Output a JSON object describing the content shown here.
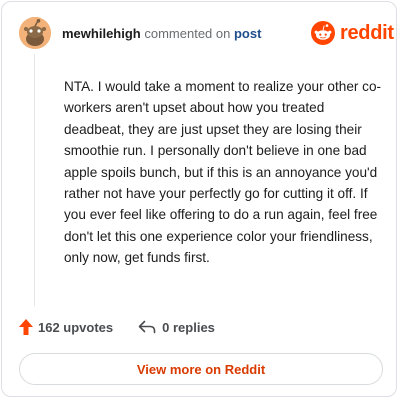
{
  "header": {
    "username": "mewhilehigh",
    "action_text": "commented on",
    "post_link": "post",
    "logo_text": "reddit"
  },
  "comment": {
    "body": "NTA. I would take a moment to realize your other co-workers aren't upset about how you treated deadbeat, they are just upset they are losing their smoothie run. I personally don't believe in one bad apple spoils bunch, but if this is an annoyance you'd rather not have your perfectly go for cutting it off. If you ever feel like offering to do a run again, feel free don't let this one experience color your friendliness, only now, get funds first."
  },
  "actions": {
    "upvotes": "162 upvotes",
    "replies": "0 replies"
  },
  "footer": {
    "view_more_label": "View more on Reddit"
  },
  "colors": {
    "brand": "#ff4500",
    "link": "#1f4e8c",
    "view_more": "#d93a00"
  },
  "icons": {
    "avatar": "snoo-avatar-icon",
    "logo": "reddit-snoo-icon",
    "upvote": "upvote-arrow-icon",
    "reply": "reply-arrow-icon"
  }
}
